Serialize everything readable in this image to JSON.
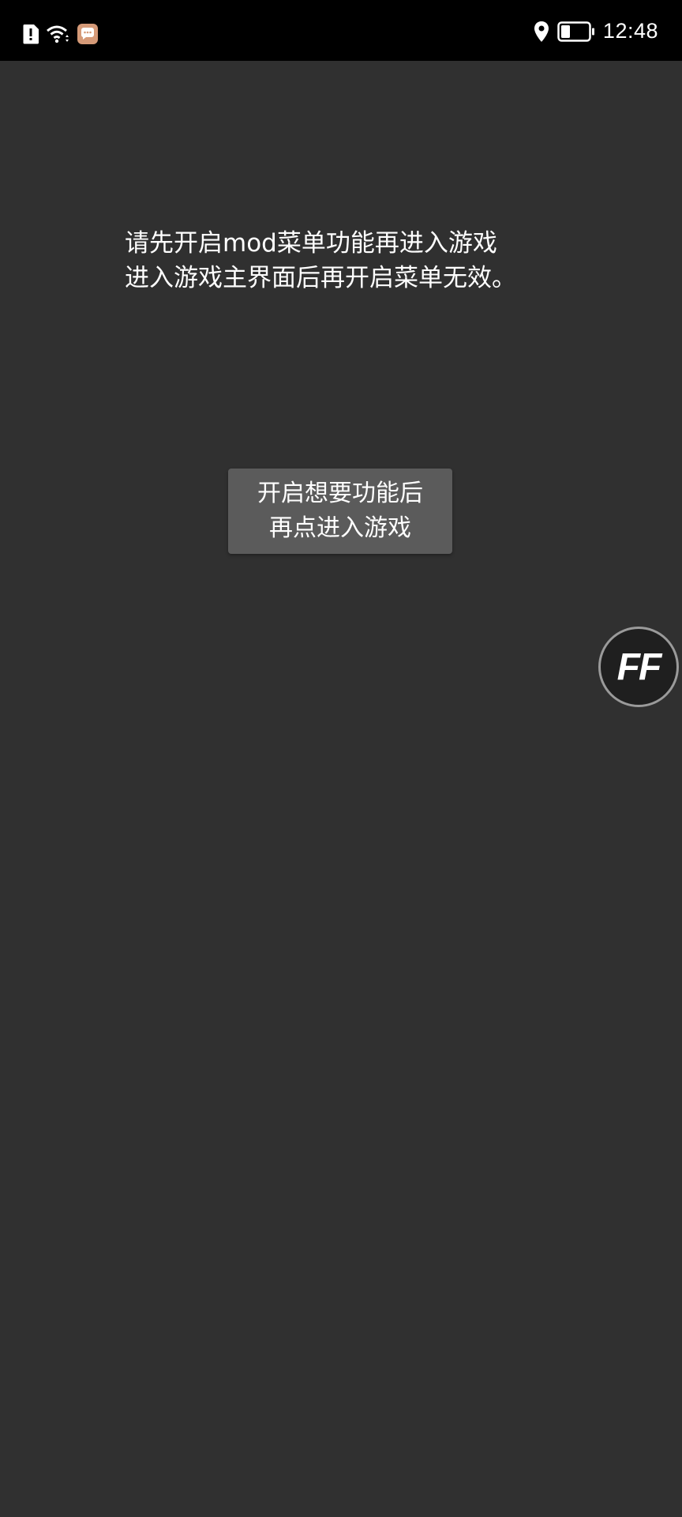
{
  "status_bar": {
    "time": "12:48",
    "icons": {
      "alert": "sim-alert-icon",
      "wifi": "wifi-icon",
      "message": "message-app-icon",
      "location": "location-icon",
      "battery": "battery-icon"
    },
    "battery_level": 0.3,
    "colors": {
      "background": "#000000",
      "foreground": "#ffffff",
      "message_badge": "#d59a78"
    }
  },
  "main": {
    "notice_lines": [
      "请先开启mod菜单功能再进入游戏",
      "进入游戏主界面后再开启菜单无效。"
    ],
    "enter_button": {
      "lines": [
        "开启想要功能后",
        "再点进入游戏"
      ]
    },
    "floating_button": {
      "label": "FF"
    },
    "colors": {
      "background": "#303030",
      "button": "#5b5b5b",
      "text": "#ffffff"
    }
  }
}
